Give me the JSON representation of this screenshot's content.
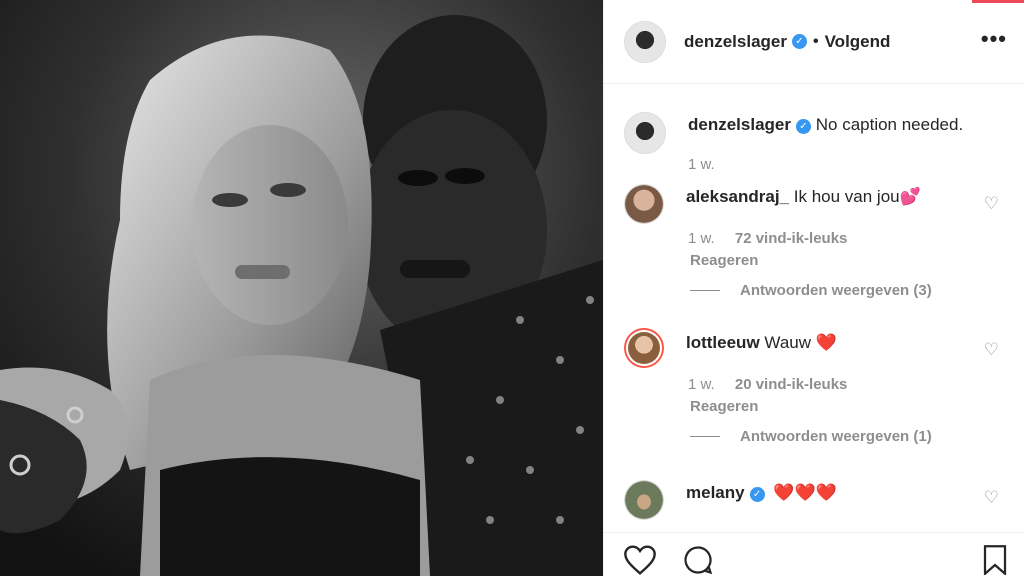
{
  "header": {
    "username": "denzelslager",
    "verified_mark": "✓",
    "separator": "•",
    "follow_status": "Volgend",
    "more_label": "•••"
  },
  "caption": {
    "username": "denzelslager",
    "verified_mark": "✓",
    "text": "No caption needed.",
    "age": "1 w."
  },
  "comments": [
    {
      "username": "aleksandraj_",
      "text": "Ik hou van jou💕",
      "age": "1 w.",
      "likes": "72 vind-ik-leuks",
      "reply_label": "Reageren",
      "view_replies": "Antwoorden weergeven (3)"
    },
    {
      "username": "lottleeuw",
      "text": "Wauw ❤️",
      "age": "1 w.",
      "likes": "20 vind-ik-leuks",
      "reply_label": "Reageren",
      "view_replies": "Antwoorden weergeven (1)"
    },
    {
      "username": "melany",
      "verified_mark": "✓",
      "text": "❤️❤️❤️"
    }
  ],
  "icons": {
    "like": "heart-icon",
    "comment": "comment-icon",
    "save": "bookmark-icon",
    "more": "more-icon",
    "comment_like": "heart-icon"
  },
  "colors": {
    "verified": "#3897f0",
    "accent": "#ed4956",
    "muted": "#8e8e8e"
  }
}
